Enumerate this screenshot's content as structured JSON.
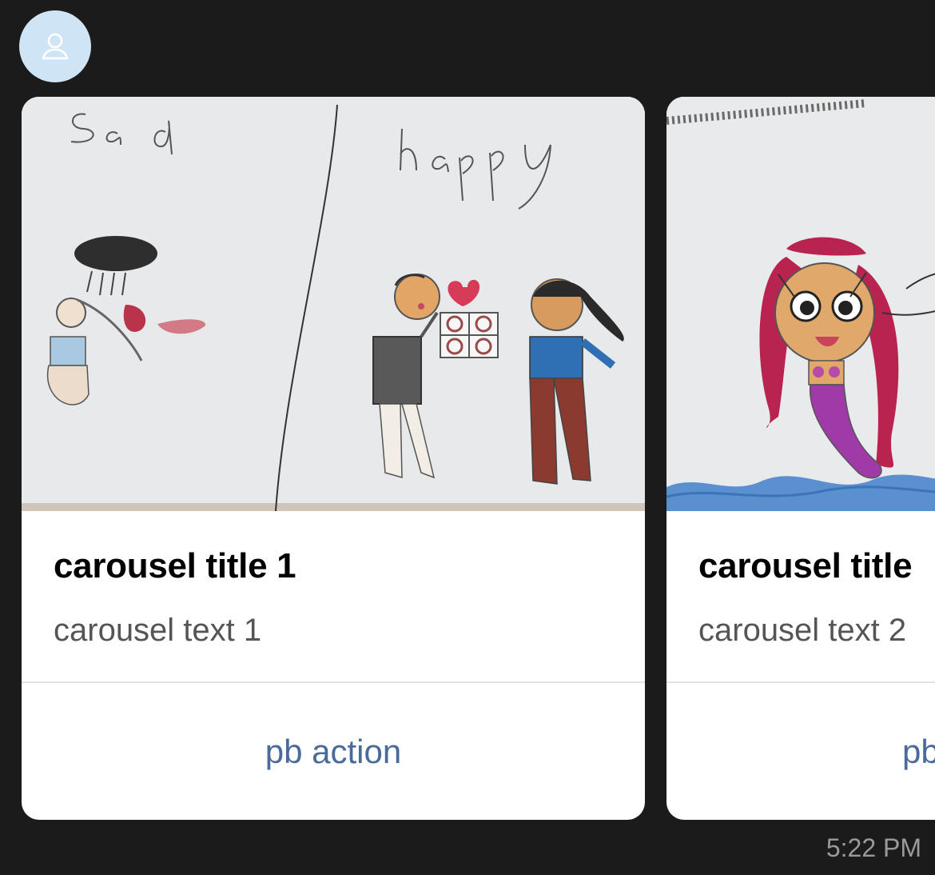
{
  "sender": {
    "avatar_icon": "person-icon",
    "avatar_color": "#cfe4f5"
  },
  "carousel": {
    "cards": [
      {
        "image_description_icon": "drawing-image",
        "title": "carousel title 1",
        "text": "carousel text 1",
        "action": "pb action"
      },
      {
        "image_description_icon": "drawing-image",
        "title": "carousel title",
        "text": "carousel text 2",
        "action": "pb"
      }
    ]
  },
  "message": {
    "timestamp": "5:22 PM"
  },
  "colors": {
    "background": "#1b1b1b",
    "card": "#ffffff",
    "action_link": "#4a6a9a",
    "muted_text": "#555555"
  }
}
